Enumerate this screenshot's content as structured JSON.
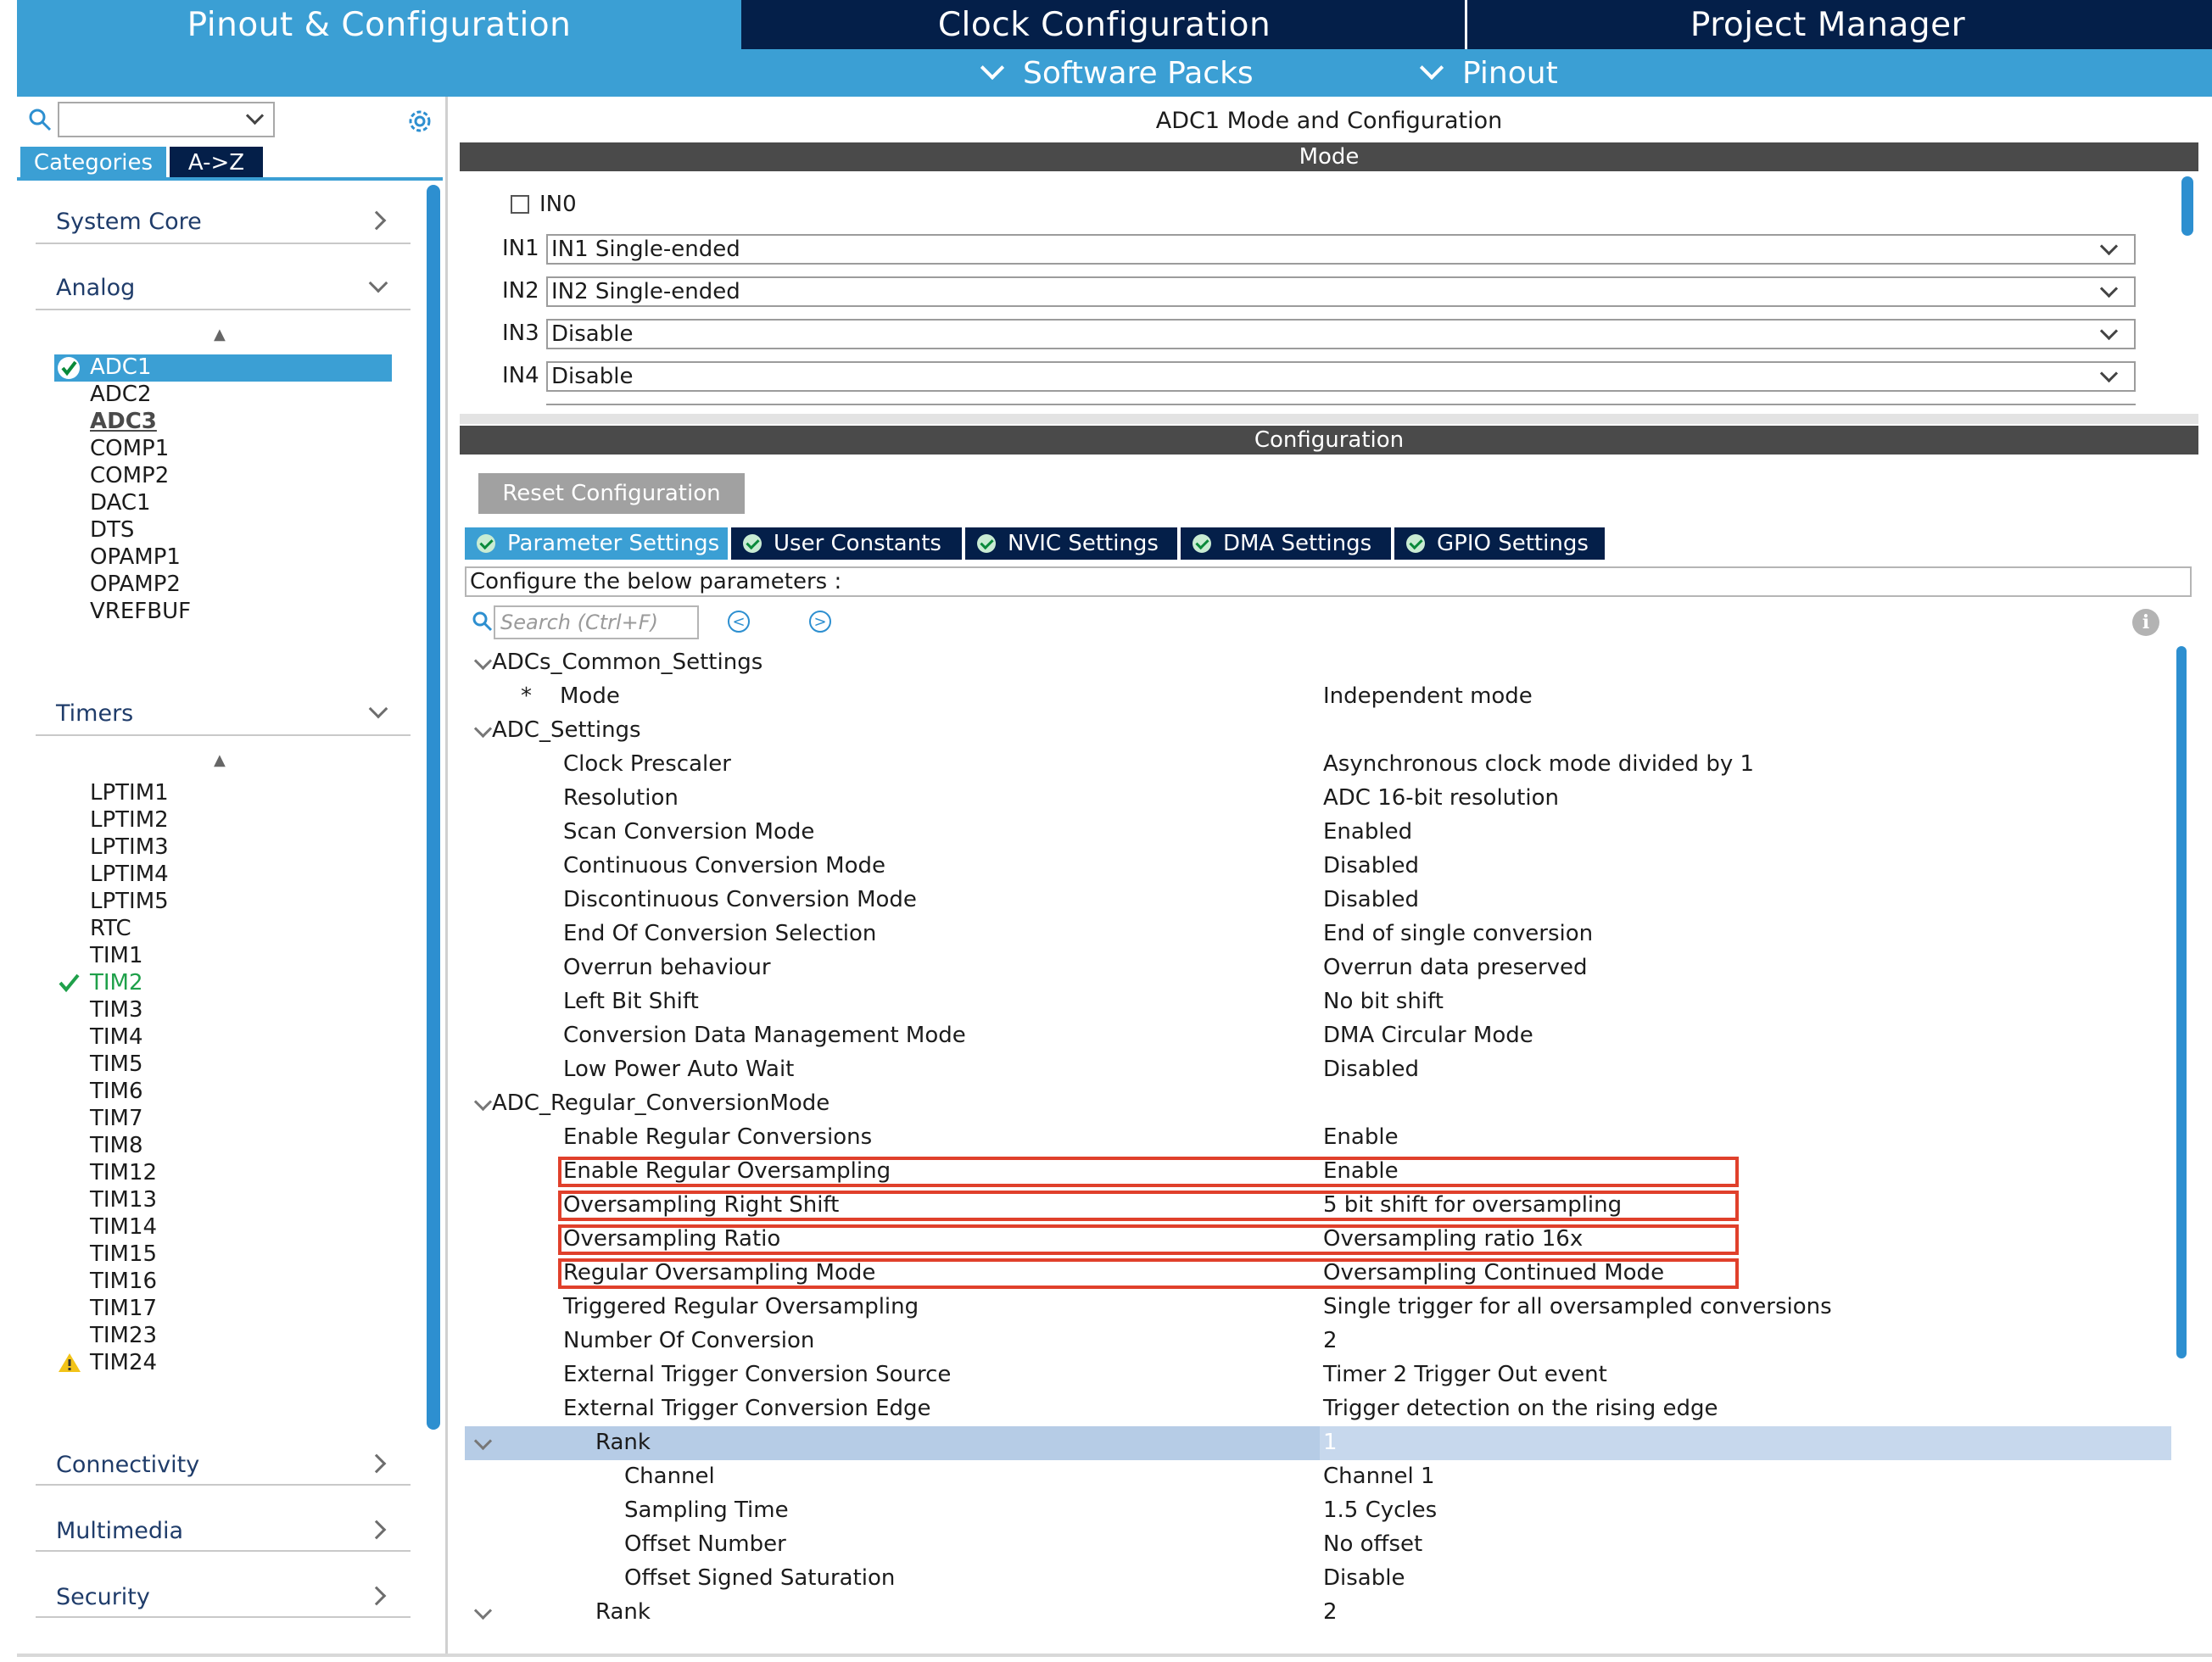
{
  "top_tabs": [
    "Pinout & Configuration",
    "Clock Configuration",
    "Project Manager"
  ],
  "sub_menu": [
    "Software Packs",
    "Pinout"
  ],
  "left": {
    "search_value": "",
    "tabs": [
      "Categories",
      "A->Z"
    ],
    "categories": {
      "system_core": "System Core",
      "analog": "Analog",
      "timers": "Timers",
      "connectivity": "Connectivity",
      "multimedia": "Multimedia",
      "security": "Security"
    },
    "analog_items": [
      "ADC1",
      "ADC2",
      "ADC3",
      "COMP1",
      "COMP2",
      "DAC1",
      "DTS",
      "OPAMP1",
      "OPAMP2",
      "VREFBUF"
    ],
    "timer_items": [
      "LPTIM1",
      "LPTIM2",
      "LPTIM3",
      "LPTIM4",
      "LPTIM5",
      "RTC",
      "TIM1",
      "TIM2",
      "TIM3",
      "TIM4",
      "TIM5",
      "TIM6",
      "TIM7",
      "TIM8",
      "TIM12",
      "TIM13",
      "TIM14",
      "TIM15",
      "TIM16",
      "TIM17",
      "TIM23",
      "TIM24"
    ]
  },
  "main": {
    "title": "ADC1 Mode and Configuration",
    "mode_header": "Mode",
    "in0_label": "IN0",
    "inputs": [
      {
        "label": "IN1",
        "value": "IN1 Single-ended"
      },
      {
        "label": "IN2",
        "value": "IN2 Single-ended"
      },
      {
        "label": "IN3",
        "value": "Disable"
      },
      {
        "label": "IN4",
        "value": "Disable"
      }
    ],
    "config_header": "Configuration",
    "reset_button": "Reset Configuration",
    "tabs": [
      "Parameter Settings",
      "User Constants",
      "NVIC Settings",
      "DMA Settings",
      "GPIO Settings"
    ],
    "configure_text": "Configure the below parameters :",
    "search_placeholder": "Search (Ctrl+F)",
    "info_glyph": "i",
    "mode_marker": "*",
    "params": [
      {
        "name": "ADCs_Common_Settings",
        "value": ""
      },
      {
        "name": "Mode",
        "value": "Independent mode"
      },
      {
        "name": "ADC_Settings",
        "value": ""
      },
      {
        "name": "Clock Prescaler",
        "value": "Asynchronous clock mode divided by 1"
      },
      {
        "name": "Resolution",
        "value": "ADC 16-bit resolution"
      },
      {
        "name": "Scan Conversion Mode",
        "value": "Enabled"
      },
      {
        "name": "Continuous Conversion Mode",
        "value": "Disabled"
      },
      {
        "name": "Discontinuous Conversion Mode",
        "value": "Disabled"
      },
      {
        "name": "End Of Conversion Selection",
        "value": "End of single conversion"
      },
      {
        "name": "Overrun behaviour",
        "value": "Overrun data preserved"
      },
      {
        "name": "Left Bit Shift",
        "value": "No bit shift"
      },
      {
        "name": "Conversion Data Management Mode",
        "value": "DMA Circular Mode"
      },
      {
        "name": "Low Power Auto Wait",
        "value": "Disabled"
      },
      {
        "name": "ADC_Regular_ConversionMode",
        "value": ""
      },
      {
        "name": "Enable Regular Conversions",
        "value": "Enable"
      },
      {
        "name": "Enable Regular Oversampling",
        "value": "Enable"
      },
      {
        "name": "Oversampling Right Shift",
        "value": "5 bit shift for oversampling"
      },
      {
        "name": "Oversampling Ratio",
        "value": "Oversampling ratio 16x"
      },
      {
        "name": "Regular Oversampling Mode",
        "value": "Oversampling Continued Mode"
      },
      {
        "name": "Triggered Regular Oversampling",
        "value": "Single trigger for all oversampled conversions"
      },
      {
        "name": "Number Of Conversion",
        "value": "2"
      },
      {
        "name": "External Trigger Conversion Source",
        "value": "Timer 2 Trigger Out event"
      },
      {
        "name": "External Trigger Conversion Edge",
        "value": "Trigger detection on the rising edge"
      },
      {
        "name": "Rank",
        "value": "1"
      },
      {
        "name": "Channel",
        "value": "Channel 1"
      },
      {
        "name": "Sampling Time",
        "value": "1.5 Cycles"
      },
      {
        "name": "Offset Number",
        "value": "No offset"
      },
      {
        "name": "Offset Signed Saturation",
        "value": "Disable"
      },
      {
        "name": "Rank",
        "value": "2"
      }
    ]
  },
  "colors": {
    "accent": "#3b9fd4",
    "navy": "#041f49",
    "highlight": "#e0402b",
    "selected_row": "#b6cce6"
  }
}
